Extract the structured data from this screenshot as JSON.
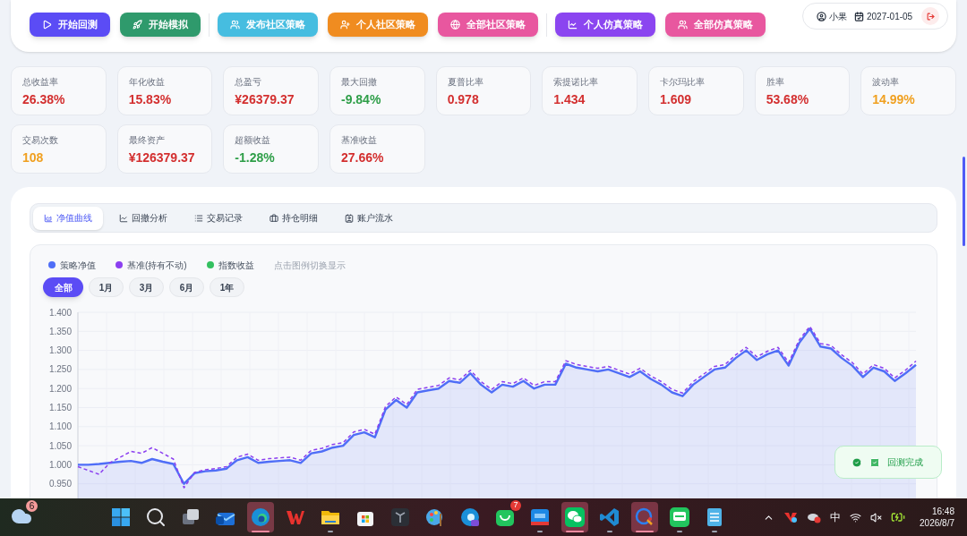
{
  "toolbar": {
    "groups": [
      {
        "buttons": [
          {
            "label": "开始回测",
            "color": "#5b4cf5"
          },
          {
            "label": "开始模拟",
            "color": "#2f9a6c"
          }
        ]
      },
      {
        "buttons": [
          {
            "label": "发布社区策略",
            "color": "#46bde0"
          },
          {
            "label": "个人社区策略",
            "color": "#f08c20"
          },
          {
            "label": "全部社区策略",
            "color": "#e8579f"
          }
        ]
      },
      {
        "buttons": [
          {
            "label": "个人仿真策略",
            "color": "#8b45f0"
          },
          {
            "label": "全部仿真策略",
            "color": "#e8579f"
          }
        ]
      }
    ]
  },
  "user": {
    "name": "小果",
    "date": "2027-01-05"
  },
  "metrics": [
    {
      "label": "总收益率",
      "value": "26.38%",
      "color": "#d32f2f"
    },
    {
      "label": "年化收益",
      "value": "15.83%",
      "color": "#d32f2f"
    },
    {
      "label": "总盈亏",
      "value": "¥26379.37",
      "color": "#d32f2f"
    },
    {
      "label": "最大回撤",
      "value": "-9.84%",
      "color": "#2e9e48"
    },
    {
      "label": "夏普比率",
      "value": "0.978",
      "color": "#d32f2f"
    },
    {
      "label": "索提诺比率",
      "value": "1.434",
      "color": "#d32f2f"
    },
    {
      "label": "卡尔玛比率",
      "value": "1.609",
      "color": "#d32f2f"
    },
    {
      "label": "胜率",
      "value": "53.68%",
      "color": "#d32f2f"
    },
    {
      "label": "波动率",
      "value": "14.99%",
      "color": "#f0a020"
    },
    {
      "label": "交易次数",
      "value": "108",
      "color": "#f0a020"
    },
    {
      "label": "最终资产",
      "value": "¥126379.37",
      "color": "#d32f2f"
    },
    {
      "label": "超额收益",
      "value": "-1.28%",
      "color": "#2e9e48"
    },
    {
      "label": "基准收益",
      "value": "27.66%",
      "color": "#d32f2f"
    }
  ],
  "tabs": [
    {
      "label": "净值曲线",
      "selected": true
    },
    {
      "label": "回撤分析",
      "selected": false
    },
    {
      "label": "交易记录",
      "selected": false
    },
    {
      "label": "持仓明细",
      "selected": false
    },
    {
      "label": "账户流水",
      "selected": false
    }
  ],
  "legend_extra": [
    {
      "label": "指数收益",
      "color": "#34c060"
    }
  ],
  "legend_hint": "点击图例切换显示",
  "ranges": [
    {
      "label": "全部",
      "selected": true
    },
    {
      "label": "1月",
      "selected": false
    },
    {
      "label": "3月",
      "selected": false
    },
    {
      "label": "6月",
      "selected": false
    },
    {
      "label": "1年",
      "selected": false
    }
  ],
  "chart_data": {
    "type": "line",
    "grid": true,
    "ylim": [
      0.9,
      1.4
    ],
    "yticks": [
      {
        "value": 0.95,
        "label": "0.950"
      },
      {
        "value": 1.0,
        "label": "1.000"
      },
      {
        "value": 1.05,
        "label": "1.050"
      },
      {
        "value": 1.1,
        "label": "1.100"
      },
      {
        "value": 1.15,
        "label": "1.150"
      },
      {
        "value": 1.2,
        "label": "1.200"
      },
      {
        "value": 1.25,
        "label": "1.250"
      },
      {
        "value": 1.3,
        "label": "1.300"
      },
      {
        "value": 1.35,
        "label": "1.350"
      },
      {
        "value": 1.4,
        "label": "1.400"
      }
    ],
    "series": [
      {
        "name": "策略净值",
        "color": "#4f6ef7",
        "type": "area",
        "line_style": "solid",
        "values": [
          1.0,
          1.0,
          1.002,
          1.005,
          1.008,
          1.01,
          1.005,
          1.015,
          1.008,
          1.002,
          0.95,
          0.978,
          0.983,
          0.985,
          0.99,
          1.012,
          1.02,
          1.005,
          1.008,
          1.01,
          1.012,
          1.005,
          1.03,
          1.035,
          1.045,
          1.05,
          1.078,
          1.085,
          1.072,
          1.145,
          1.17,
          1.15,
          1.19,
          1.195,
          1.2,
          1.22,
          1.215,
          1.24,
          1.21,
          1.19,
          1.21,
          1.205,
          1.22,
          1.2,
          1.21,
          1.21,
          1.265,
          1.255,
          1.25,
          1.245,
          1.25,
          1.24,
          1.23,
          1.245,
          1.225,
          1.21,
          1.19,
          1.18,
          1.21,
          1.23,
          1.25,
          1.255,
          1.28,
          1.3,
          1.275,
          1.29,
          1.3,
          1.26,
          1.32,
          1.357,
          1.31,
          1.305,
          1.28,
          1.26,
          1.23,
          1.255,
          1.245,
          1.22,
          1.24,
          1.262
        ]
      },
      {
        "name": "基准(持有不动)",
        "color": "#8b3ff0",
        "type": "line",
        "line_style": "dashed",
        "values": [
          0.995,
          0.985,
          0.975,
          1.005,
          1.02,
          1.035,
          1.03,
          1.045,
          1.03,
          1.015,
          0.94,
          0.98,
          0.987,
          0.99,
          0.995,
          1.02,
          1.028,
          1.012,
          1.016,
          1.018,
          1.02,
          1.012,
          1.038,
          1.043,
          1.053,
          1.058,
          1.086,
          1.093,
          1.08,
          1.153,
          1.178,
          1.158,
          1.198,
          1.203,
          1.208,
          1.228,
          1.223,
          1.248,
          1.218,
          1.198,
          1.218,
          1.213,
          1.228,
          1.208,
          1.218,
          1.218,
          1.273,
          1.263,
          1.258,
          1.253,
          1.258,
          1.248,
          1.238,
          1.253,
          1.233,
          1.218,
          1.198,
          1.188,
          1.218,
          1.238,
          1.258,
          1.263,
          1.288,
          1.308,
          1.283,
          1.298,
          1.308,
          1.268,
          1.328,
          1.363,
          1.318,
          1.313,
          1.288,
          1.268,
          1.238,
          1.263,
          1.253,
          1.228,
          1.248,
          1.272
        ]
      }
    ]
  },
  "toast": {
    "message": "回测完成"
  },
  "taskbar": {
    "weather_badge": "6",
    "apps": [
      {
        "kind": "start",
        "running": false,
        "focused": false
      },
      {
        "kind": "search",
        "running": false,
        "focused": false
      },
      {
        "kind": "taskview",
        "running": false,
        "focused": false
      },
      {
        "kind": "mail",
        "running": false,
        "focused": false
      },
      {
        "kind": "browser",
        "running": true,
        "focused": true
      },
      {
        "kind": "office",
        "running": false,
        "focused": false
      },
      {
        "kind": "folder",
        "running": true,
        "focused": false
      },
      {
        "kind": "store",
        "running": false,
        "focused": false
      },
      {
        "kind": "dark",
        "running": false,
        "focused": false
      },
      {
        "kind": "paint",
        "running": false,
        "focused": false
      },
      {
        "kind": "browser-ai",
        "running": false,
        "focused": false
      },
      {
        "kind": "bag",
        "running": false,
        "focused": false,
        "badge": "7"
      },
      {
        "kind": "ticket",
        "running": true,
        "focused": false
      },
      {
        "kind": "chat",
        "running": true,
        "focused": true
      },
      {
        "kind": "code",
        "running": true,
        "focused": false
      },
      {
        "kind": "bubble",
        "running": true,
        "focused": true
      },
      {
        "kind": "message",
        "running": true,
        "focused": false
      },
      {
        "kind": "notepad",
        "running": true,
        "focused": false
      }
    ],
    "ime": "中",
    "time": "16:48",
    "date": "2026/8/7"
  }
}
